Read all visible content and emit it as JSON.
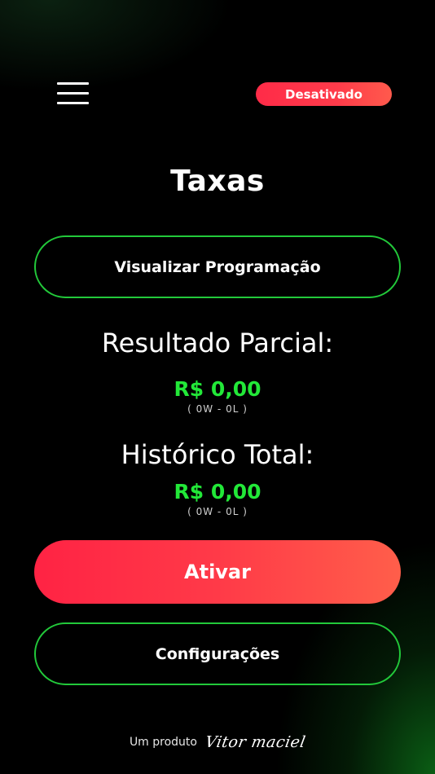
{
  "header": {
    "menu_icon": "hamburger-menu-icon",
    "status_badge": "Desativado",
    "status_color": "#ff2b48"
  },
  "title": "Taxas",
  "buttons": {
    "view_schedule": "Visualizar Programação",
    "activate": "Ativar",
    "settings": "Configurações"
  },
  "partial": {
    "label": "Resultado Parcial:",
    "amount": "R$ 0,00",
    "record": "( 0W - 0L )"
  },
  "total": {
    "label": "Histórico Total:",
    "amount": "R$ 0,00",
    "record": "( 0W - 0L )"
  },
  "footer": {
    "prefix": "Um produto",
    "signature": "Vitor maciel"
  },
  "colors": {
    "accent_green": "#22e838",
    "outline_green": "#22c93a",
    "primary_red": "#ff2344"
  }
}
